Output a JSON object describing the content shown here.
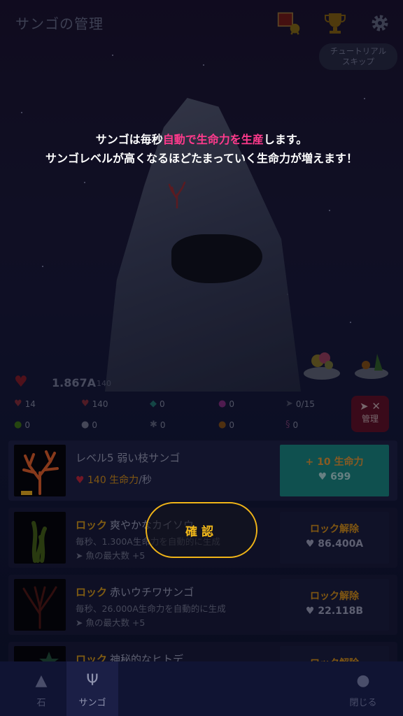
{
  "header": {
    "title": "サンゴの管理",
    "tutorial_skip": [
      "チュートリアル",
      "スキップ"
    ]
  },
  "tutorial": {
    "line1_pre": "サンゴは毎秒",
    "line1_hl1": "自動で",
    "line1_hl2": "生命力を生産",
    "line1_post": "します。",
    "line2": "サンゴレベルが高くなるほどたまっていく生命力が増えます！"
  },
  "stats": {
    "life_total": "1.867A",
    "life_rate": "140",
    "row1": [
      {
        "icon": "tap-heart-icon",
        "value": "14"
      },
      {
        "icon": "auto-heart-icon",
        "value": "140"
      },
      {
        "icon": "gem-icon",
        "value": "0"
      },
      {
        "icon": "pearl-icon",
        "value": "0"
      },
      {
        "icon": "fish-count-icon",
        "value": "0/15"
      }
    ],
    "row2": [
      {
        "icon": "seaweed-icon",
        "value": "0"
      },
      {
        "icon": "shell-icon",
        "value": "0"
      },
      {
        "icon": "anemone-icon",
        "value": "0"
      },
      {
        "icon": "crab-icon",
        "value": "0"
      },
      {
        "icon": "seahorse-icon",
        "value": "0"
      }
    ],
    "manage_label": "管理"
  },
  "corals": [
    {
      "title": "レベル5 弱い枝サンゴ",
      "production": "140 生命力",
      "production_unit": "/秒",
      "action_line1": "+ 10 生命力",
      "action_line2": "699"
    },
    {
      "lock_label": "ロック",
      "title": "爽やかなカイソウ",
      "desc": "毎秒、1.300A生命力を自動的に生成",
      "fish": "魚の最大数 +5",
      "action_line1": "ロック解除",
      "action_line2": "86.400A"
    },
    {
      "lock_label": "ロック",
      "title": "赤いウチワサンゴ",
      "desc": "毎秒、26.000A生命力を自動的に生成",
      "fish": "魚の最大数 +5",
      "action_line1": "ロック解除",
      "action_line2": "22.118B"
    },
    {
      "lock_label": "ロック",
      "title": "神秘的なヒトデ",
      "action_line1": "ロック解除"
    }
  ],
  "confirm_label": "確認",
  "nav": {
    "rock": "石",
    "coral": "サンゴ",
    "close": "閉じる"
  },
  "colors": {
    "highlight_pink": "#ff3a8c",
    "accent_gold": "#f2b81a",
    "teal": "#177c7a"
  }
}
